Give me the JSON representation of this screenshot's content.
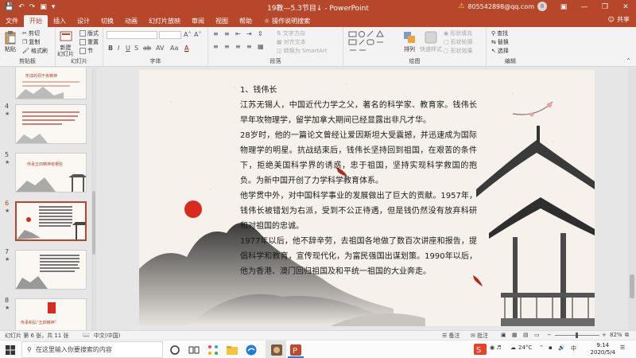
{
  "window": {
    "title": "19教—5.3节目↓  -  PowerPoint",
    "account_email": "805542898@qq.com",
    "account_initial": "8"
  },
  "menu": {
    "tabs": [
      "文件",
      "开始",
      "插入",
      "设计",
      "切换",
      "动画",
      "幻灯片放映",
      "审阅",
      "视图",
      "帮助"
    ],
    "active_tab": "开始",
    "tell_me": "操作说明搜索",
    "share": "共享"
  },
  "ribbon": {
    "clipboard": {
      "label": "剪贴板",
      "paste": "粘贴",
      "cut": "剪切",
      "copy": "复制",
      "format_painter": "格式刷"
    },
    "slides": {
      "label": "幻灯片",
      "new_slide": "新建\n幻灯片",
      "layout": "版式",
      "reset": "重置",
      "section": "节"
    },
    "font": {
      "label": "字体",
      "bold": "B",
      "italic": "I",
      "underline": "U",
      "strike": "S",
      "shadow": "ab",
      "spacing": "AV",
      "case": "Aa",
      "color": "A"
    },
    "paragraph": {
      "label": "段落",
      "text_direction": "文字方向",
      "align_text": "对齐文本",
      "smartart": "转换为 SmartArt"
    },
    "drawing": {
      "label": "绘图",
      "arrange": "排列",
      "quick_styles": "快速样式",
      "shape_fill": "形状填充",
      "shape_outline": "形状轮廓",
      "shape_effects": "形状效果"
    },
    "editing": {
      "label": "编辑",
      "find": "查找",
      "replace": "替换",
      "select": "选择"
    }
  },
  "thumbnails": [
    {
      "number": "",
      "title": "形成的洞干肯精神"
    },
    {
      "number": "4",
      "title": ""
    },
    {
      "number": "5",
      "title": "传承五四精神有哪些"
    },
    {
      "number": "6",
      "title": "",
      "active": true
    },
    {
      "number": "7",
      "title": ""
    },
    {
      "number": "8",
      "title": "传承和弘“五四精神”"
    }
  ],
  "slide": {
    "heading": "1、钱伟长",
    "paragraphs": [
      "江苏无锡人，中国近代力学之父，著名的科学家、教育家。钱伟长早年攻物理学，留学加拿大期间已经显露出非凡才华。",
      "28岁时，他的一篇论文曾经让爱因斯坦大受震撼，并迅速成为国际物理学的明星。抗战结束后，钱伟长坚持回到祖国，在艰苦的条件下，拒绝美国科学界的诱惑，忠于祖国，坚持实现科学救国的抱负。为新中国开创了力学科学教育体系。",
      "他学贯中外，对中国科学事业的发展做出了巨大的贡献。1957年，钱伟长被错划为右派，受到不公正待遇，但是钱仍然没有放弃科研和对祖国的忠诚。",
      "1977年以后，他不辞辛劳，去祖国各地做了数百次讲座和报告，提倡科学和教育，宣传现代化，为富民强国出谋划策。1990年以后，他为香港、澳门回归祖国及和平统一祖国的大业奔走。"
    ]
  },
  "status": {
    "slide_of": "幻灯片 第 6 张，共 11 张",
    "language": "中文(中国)",
    "notes": "备注",
    "comments": "批注",
    "zoom": "82%"
  },
  "taskbar": {
    "search_placeholder": "在这里输入你要搜索的内容",
    "temperature": "24°C",
    "ime": "中",
    "time": "9:14",
    "date": "2020/5/4"
  },
  "colors": {
    "accent": "#b7472a",
    "seal_red": "#d82a1f"
  }
}
